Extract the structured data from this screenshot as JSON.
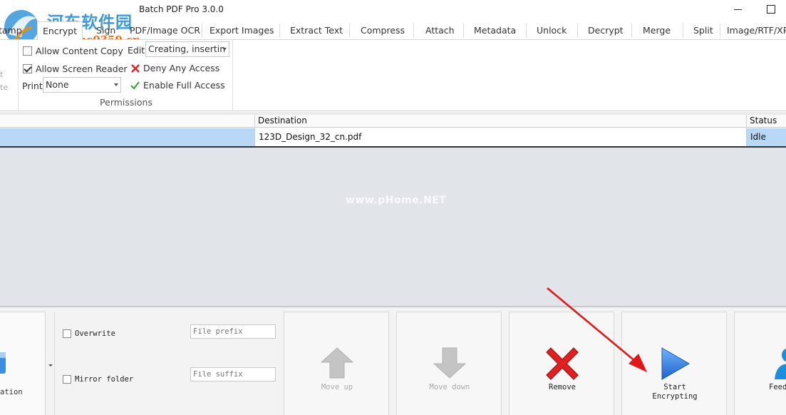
{
  "window": {
    "title": "Batch PDF Pro 3.0.0"
  },
  "watermark": {
    "cn": "河东软件园",
    "url": "www.pc0359.cn",
    "center": "www.pHome.NET"
  },
  "tabs": [
    {
      "label": "tamp"
    },
    {
      "label": "Encrypt",
      "active": true
    },
    {
      "label": "Sign"
    },
    {
      "label": "PDF/Image OCR"
    },
    {
      "label": "Export Images"
    },
    {
      "label": "Extract Text"
    },
    {
      "label": "Compress"
    },
    {
      "label": "Attach"
    },
    {
      "label": "Metadata"
    },
    {
      "label": "Unlock"
    },
    {
      "label": "Decrypt"
    },
    {
      "label": "Merge"
    },
    {
      "label": "Split"
    },
    {
      "label": "Image/RTF/XP"
    }
  ],
  "ribbon": {
    "left_ghost": [
      "t",
      "te"
    ],
    "permissions": {
      "group_label": "Permissions",
      "allow_content_copy": {
        "label": "Allow Content Copy",
        "checked": false
      },
      "allow_screen_reader": {
        "label": "Allow Screen Reader",
        "checked": true
      },
      "print_label": "Print",
      "print_value": "None",
      "edit_label": "Edit",
      "edit_value": "Creating, insertin",
      "deny_any_access": "Deny Any Access",
      "enable_full_access": "Enable Full Access"
    }
  },
  "table": {
    "columns": [
      "Destination",
      "Status"
    ],
    "rows": [
      {
        "destination": "123D_Design_32_cn.pdf",
        "status": "Idle"
      }
    ]
  },
  "bottom": {
    "destination_label": "ation",
    "overwrite": {
      "label": "Overwrite",
      "checked": false
    },
    "mirror_folder": {
      "label": "Mirror folder",
      "checked": false
    },
    "file_prefix_placeholder": "File prefix",
    "file_suffix_placeholder": "File suffix",
    "buttons": {
      "move_up": "Move up",
      "move_down": "Move down",
      "remove": "Remove",
      "start_line1": "Start",
      "start_line2": "Encrypting",
      "feedback": "Feed"
    }
  },
  "colors": {
    "selection": "#b8d8f5",
    "workspace": "#e1e4e8",
    "accent_blue": "#2a7fd8",
    "remove_red": "#e02020"
  }
}
